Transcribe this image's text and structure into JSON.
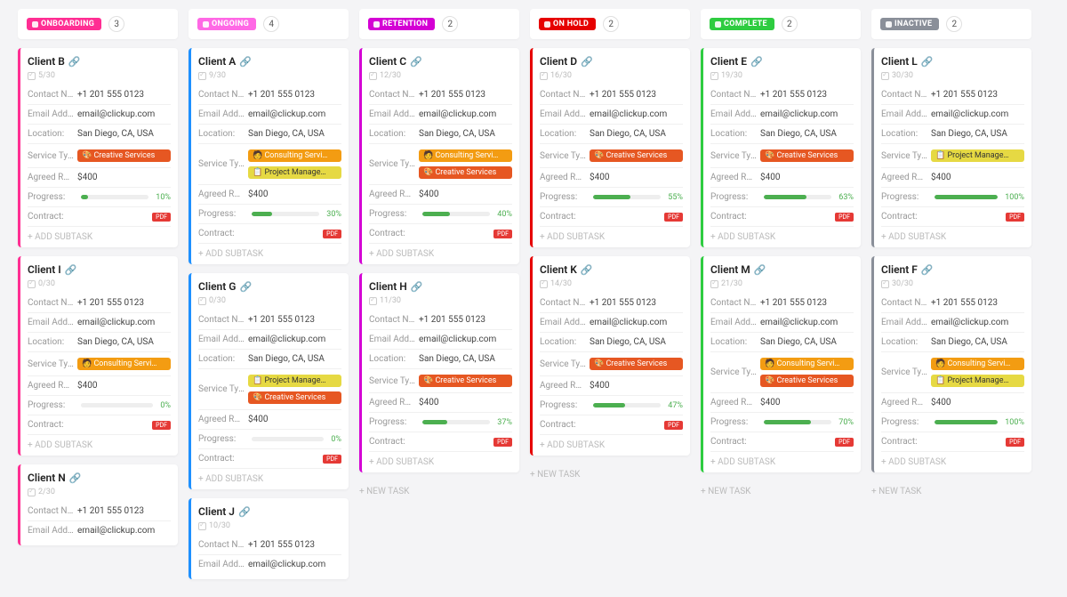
{
  "columns": [
    {
      "id": "onboarding",
      "label": "ONBOARDING",
      "color": "#ff2e93",
      "border": "#ff2e93",
      "count": "3",
      "cards": [
        {
          "name": "Client B",
          "todo": "5/30",
          "progress": 10,
          "tags": [
            {
              "t": "creative",
              "l": "🎨 Creative Services"
            }
          ]
        },
        {
          "name": "Client I",
          "todo": "0/30",
          "progress": 0,
          "tags": [
            {
              "t": "consulting",
              "l": "🧑 Consulting Servi…"
            }
          ]
        },
        {
          "name": "Client N",
          "todo": "2/30",
          "progress": null,
          "tags": [],
          "truncated": true
        }
      ],
      "footer": null
    },
    {
      "id": "ongoing",
      "label": "ONGOING",
      "color": "#ff68e5",
      "border": "#1e90ff",
      "count": "4",
      "cards": [
        {
          "name": "Client A",
          "todo": "9/30",
          "progress": 30,
          "tags": [
            {
              "t": "consulting",
              "l": "🧑 Consulting Servi…"
            },
            {
              "t": "project",
              "l": "📋 Project Manage…"
            }
          ]
        },
        {
          "name": "Client G",
          "todo": "0/30",
          "progress": 0,
          "tags": [
            {
              "t": "project",
              "l": "📋 Project Manage…"
            },
            {
              "t": "creative",
              "l": "🎨 Creative Services"
            }
          ]
        },
        {
          "name": "Client J",
          "todo": "10/30",
          "progress": null,
          "tags": [],
          "truncated": true
        }
      ],
      "footer": null
    },
    {
      "id": "retention",
      "label": "RETENTION",
      "color": "#d400d4",
      "border": "#d400d4",
      "count": "2",
      "cards": [
        {
          "name": "Client C",
          "todo": "12/30",
          "progress": 40,
          "tags": [
            {
              "t": "consulting",
              "l": "🧑 Consulting Servi…"
            },
            {
              "t": "creative",
              "l": "🎨 Creative Services"
            }
          ]
        },
        {
          "name": "Client H",
          "todo": "11/30",
          "progress": 37,
          "tags": [
            {
              "t": "creative",
              "l": "🎨 Creative Services"
            }
          ]
        }
      ],
      "footer": "NEW TASK"
    },
    {
      "id": "onhold",
      "label": "ON HOLD",
      "color": "#e60000",
      "border": "#e60000",
      "count": "2",
      "cards": [
        {
          "name": "Client D",
          "todo": "16/30",
          "progress": 55,
          "tags": [
            {
              "t": "creative",
              "l": "🎨 Creative Services"
            }
          ]
        },
        {
          "name": "Client K",
          "todo": "14/30",
          "progress": 47,
          "tags": [
            {
              "t": "creative",
              "l": "🎨 Creative Services"
            }
          ]
        }
      ],
      "footer": "NEW TASK"
    },
    {
      "id": "complete",
      "label": "COMPLETE",
      "color": "#2ecc40",
      "border": "#2ecc40",
      "count": "2",
      "cards": [
        {
          "name": "Client E",
          "todo": "19/30",
          "progress": 63,
          "tags": [
            {
              "t": "creative",
              "l": "🎨 Creative Services"
            }
          ]
        },
        {
          "name": "Client M",
          "todo": "21/30",
          "progress": 70,
          "tags": [
            {
              "t": "consulting",
              "l": "🧑 Consulting Servi…"
            },
            {
              "t": "creative",
              "l": "🎨 Creative Services"
            }
          ]
        }
      ],
      "footer": "NEW TASK"
    },
    {
      "id": "inactive",
      "label": "INACTIVE",
      "color": "#8a8f99",
      "border": "#8a8f99",
      "count": "2",
      "cards": [
        {
          "name": "Client L",
          "todo": "30/30",
          "progress": 100,
          "tags": [
            {
              "t": "project",
              "l": "📋 Project Manage…"
            }
          ]
        },
        {
          "name": "Client F",
          "todo": "30/30",
          "progress": 100,
          "tags": [
            {
              "t": "consulting",
              "l": "🧑 Consulting Servi…"
            },
            {
              "t": "project",
              "l": "📋 Project Manage…"
            }
          ]
        }
      ],
      "footer": "NEW TASK"
    }
  ],
  "fields": {
    "contact_label": "Contact Nu…",
    "contact_value": "+1 201 555 0123",
    "email_label": "Email Addre…",
    "email_value": "email@clickup.com",
    "location_label": "Location:",
    "location_value": "San Diego, CA, USA",
    "service_label": "Service Type:",
    "rate_label": "Agreed Rate:…",
    "rate_value": "$400",
    "progress_label": "Progress:",
    "contract_label": "Contract:",
    "add_subtask": "ADD SUBTASK",
    "pdf": "PDF"
  }
}
